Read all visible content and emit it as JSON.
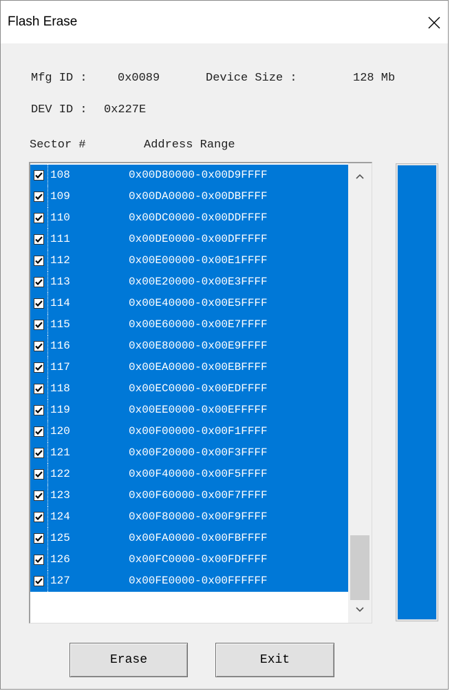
{
  "window": {
    "title": "Flash Erase"
  },
  "info": {
    "mfg_id_label": "Mfg ID :",
    "mfg_id_value": "0x0089",
    "device_size_label": "Device Size :",
    "device_size_value": "128 Mb",
    "dev_id_label": "DEV ID :",
    "dev_id_value": "0x227E"
  },
  "list": {
    "headers": {
      "sector": "Sector #",
      "address": "Address Range"
    },
    "rows": [
      {
        "sector": "108",
        "range": "0x00D80000-0x00D9FFFF",
        "checked": true
      },
      {
        "sector": "109",
        "range": "0x00DA0000-0x00DBFFFF",
        "checked": true
      },
      {
        "sector": "110",
        "range": "0x00DC0000-0x00DDFFFF",
        "checked": true
      },
      {
        "sector": "111",
        "range": "0x00DE0000-0x00DFFFFF",
        "checked": true
      },
      {
        "sector": "112",
        "range": "0x00E00000-0x00E1FFFF",
        "checked": true
      },
      {
        "sector": "113",
        "range": "0x00E20000-0x00E3FFFF",
        "checked": true
      },
      {
        "sector": "114",
        "range": "0x00E40000-0x00E5FFFF",
        "checked": true
      },
      {
        "sector": "115",
        "range": "0x00E60000-0x00E7FFFF",
        "checked": true
      },
      {
        "sector": "116",
        "range": "0x00E80000-0x00E9FFFF",
        "checked": true
      },
      {
        "sector": "117",
        "range": "0x00EA0000-0x00EBFFFF",
        "checked": true
      },
      {
        "sector": "118",
        "range": "0x00EC0000-0x00EDFFFF",
        "checked": true
      },
      {
        "sector": "119",
        "range": "0x00EE0000-0x00EFFFFF",
        "checked": true
      },
      {
        "sector": "120",
        "range": "0x00F00000-0x00F1FFFF",
        "checked": true
      },
      {
        "sector": "121",
        "range": "0x00F20000-0x00F3FFFF",
        "checked": true
      },
      {
        "sector": "122",
        "range": "0x00F40000-0x00F5FFFF",
        "checked": true
      },
      {
        "sector": "123",
        "range": "0x00F60000-0x00F7FFFF",
        "checked": true
      },
      {
        "sector": "124",
        "range": "0x00F80000-0x00F9FFFF",
        "checked": true
      },
      {
        "sector": "125",
        "range": "0x00FA0000-0x00FBFFFF",
        "checked": true
      },
      {
        "sector": "126",
        "range": "0x00FC0000-0x00FDFFFF",
        "checked": true
      },
      {
        "sector": "127",
        "range": "0x00FE0000-0x00FFFFFF",
        "checked": true
      }
    ],
    "selection_color": "#0078d7"
  },
  "progress": {
    "fraction": 1.0,
    "color": "#0078d7"
  },
  "buttons": {
    "erase": "Erase",
    "exit": "Exit"
  }
}
